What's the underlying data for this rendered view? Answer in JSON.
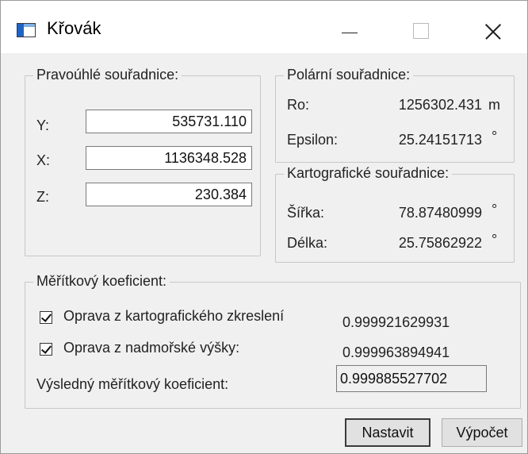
{
  "window": {
    "title": "Křovák",
    "icon": "application-window-icon"
  },
  "rectangular": {
    "title": "Pravoúhlé souřadnice:",
    "y_label": "Y:",
    "y_value": "535731.110",
    "x_label": "X:",
    "x_value": "1136348.528",
    "z_label": "Z:",
    "z_value": "230.384"
  },
  "polar": {
    "title": "Polární souřadnice:",
    "ro_label": "Ro:",
    "ro_value": "1256302.431",
    "ro_unit": "m",
    "epsilon_label": "Epsilon:",
    "epsilon_value": "25.24151713",
    "epsilon_unit": "°"
  },
  "cartographic": {
    "title": "Kartografické souřadnice:",
    "latitude_label": "Šířka:",
    "latitude_value": "78.87480999",
    "latitude_unit": "°",
    "longitude_label": "Délka:",
    "longitude_value": "25.75862922",
    "longitude_unit": "°"
  },
  "scale": {
    "title": "Měřítkový koeficient:",
    "distortion_label": "Oprava z kartografického zkreslení",
    "distortion_checked": true,
    "distortion_value": "0.999921629931",
    "elevation_label": "Oprava z nadmořské výšky:",
    "elevation_checked": true,
    "elevation_value": "0.999963894941",
    "result_label": "Výsledný měřítkový koeficient:",
    "result_value": "0.999885527702"
  },
  "buttons": {
    "set": "Nastavit",
    "compute": "Výpočet"
  }
}
